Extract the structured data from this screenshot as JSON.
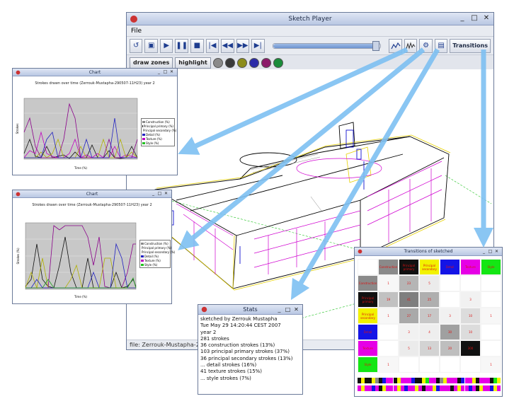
{
  "main_window": {
    "title": "Sketch Player",
    "menu": [
      "File"
    ],
    "toolbar": {
      "transitions_label": "Transitions",
      "playback_progress": 0.96,
      "buttons": [
        "open-icon",
        "save-icon",
        "play-icon",
        "pause-icon",
        "stop-icon",
        "step-back-icon",
        "rewind-icon",
        "fast-forward-icon",
        "step-forward-icon",
        "line-chart-icon",
        "stroke-chart-icon",
        "gear-icon",
        "stats-icon"
      ]
    },
    "toolbar2": {
      "draw_zones_label": "draw zones",
      "highlight_label": "highlight",
      "swatches": [
        "#8a8a8a",
        "#3a3a3a",
        "#8c8c1a",
        "#2a2aa8",
        "#8c1a6a",
        "#1a8c3a"
      ]
    },
    "status_text": "file: Zerrouk-Mustapha-290507 ..."
  },
  "chart_window_1": {
    "title": "Chart",
    "chart_title": "Strokes drawn over time (Zerrouk-Mustapha-290507-11H23) year 2",
    "xlabel": "Time (%)",
    "ylabel": "Strokes",
    "legend": [
      "Construction (%)",
      "Principal primary (%)",
      "Principal secondary (%)",
      "Detail (%)",
      "Texture (%)",
      "Style (%)"
    ]
  },
  "chart_window_2": {
    "title": "Chart",
    "chart_title": "Strokes drawn over time (Zerrouk-Mustapha-290507-11H23) year 2",
    "xlabel": "Time (%)",
    "ylabel": "Strokes (%)",
    "legend": [
      "Construction (%)",
      "Principal primary (%)",
      "Principal secondary (%)",
      "Detail (%)",
      "Texture (%)",
      "Style (%)"
    ]
  },
  "stats_window": {
    "title": "Stats",
    "lines": [
      "sketched by Zerrouk Mustapha",
      "Tue May 29 14:20:44 CEST 2007",
      "year 2",
      "",
      "281 strokes",
      "36 construction strokes (13%)",
      "103 principal primary strokes (37%)",
      "36 principal secondary strokes (13%)",
      "... detail strokes (16%)",
      "41 texture strokes (15%)",
      "... style strokes (7%)"
    ]
  },
  "transitions_window": {
    "title": "Transitions of sketched",
    "col_headers": [
      "Construction",
      "Principal primary",
      "Principal secondary",
      "Detail",
      "Texture",
      "Style"
    ],
    "row_headers": [
      "Construction",
      "Principal primary",
      "Principal secondary",
      "Detail",
      "Texture",
      "Style"
    ],
    "header_colors": [
      "#8a8a8a",
      "#111111",
      "#f2f200",
      "#1414e6",
      "#e600e6",
      "#14e614"
    ],
    "values": [
      [
        "1",
        "23",
        "5",
        "",
        "",
        ""
      ],
      [
        "19",
        "41",
        "25",
        "",
        "3",
        ""
      ],
      [
        "1",
        "27",
        "17",
        "3",
        "10",
        "1"
      ],
      [
        "",
        "3",
        "4",
        "30",
        "10",
        ""
      ],
      [
        "",
        "5",
        "13",
        "20",
        "300",
        ""
      ],
      [
        "1",
        "",
        "",
        "",
        "",
        "1"
      ]
    ]
  }
}
